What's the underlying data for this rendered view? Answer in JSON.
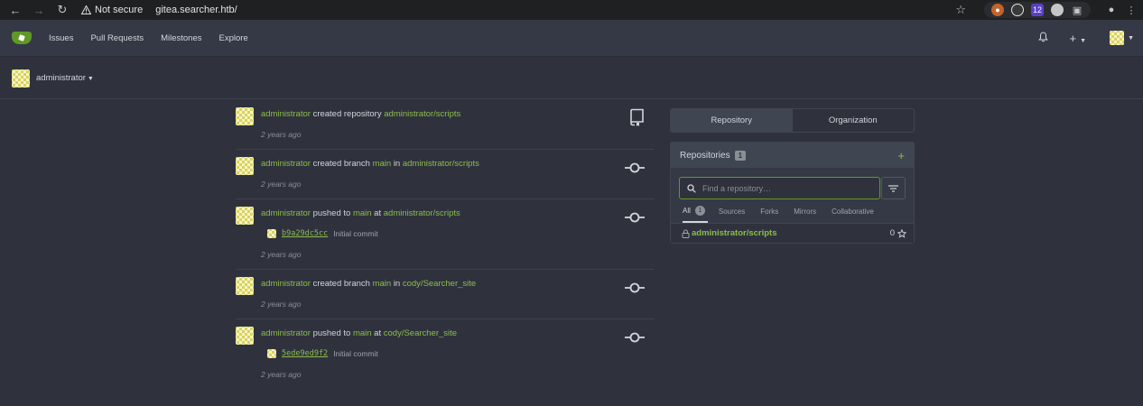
{
  "browser": {
    "security_label": "Not secure",
    "url": "gitea.searcher.htb/",
    "ext_badge": "12"
  },
  "navbar": {
    "items": [
      "Issues",
      "Pull Requests",
      "Milestones",
      "Explore"
    ]
  },
  "dashboard": {
    "context_user": "administrator"
  },
  "feed": [
    {
      "actor": "administrator",
      "verb": "created repository",
      "connector": "",
      "target": "",
      "repo": "administrator/scripts",
      "time": "2 years ago",
      "icon": "repo-icon"
    },
    {
      "actor": "administrator",
      "verb": "created branch",
      "connector": "in",
      "target": "main",
      "repo": "administrator/scripts",
      "time": "2 years ago",
      "icon": "commit-icon"
    },
    {
      "actor": "administrator",
      "verb": "pushed to",
      "connector": "at",
      "target": "main",
      "repo": "administrator/scripts",
      "commit_sha": "b9a29dc5cc",
      "commit_msg": "Initial commit",
      "time": "2 years ago",
      "icon": "commit-icon"
    },
    {
      "actor": "administrator",
      "verb": "created branch",
      "connector": "in",
      "target": "main",
      "repo": "cody/Searcher_site",
      "time": "2 years ago",
      "icon": "commit-icon"
    },
    {
      "actor": "administrator",
      "verb": "pushed to",
      "connector": "at",
      "target": "main",
      "repo": "cody/Searcher_site",
      "commit_sha": "5ede9ed9f2",
      "commit_msg": "Initial commit",
      "time": "2 years ago",
      "icon": "commit-icon"
    }
  ],
  "panel": {
    "segments": [
      "Repository",
      "Organization"
    ],
    "repos_title": "Repositories",
    "repos_count": "1",
    "search_placeholder": "Find a repository…",
    "tabs": [
      "All",
      "Sources",
      "Forks",
      "Mirrors",
      "Collaborative"
    ],
    "all_count": "1",
    "repos": [
      {
        "name": "administrator/scripts",
        "stars": "0"
      }
    ]
  },
  "colors": {
    "accent": "#609926",
    "link": "#8cbc4c",
    "background": "#2f323d",
    "navbar": "#353945"
  }
}
